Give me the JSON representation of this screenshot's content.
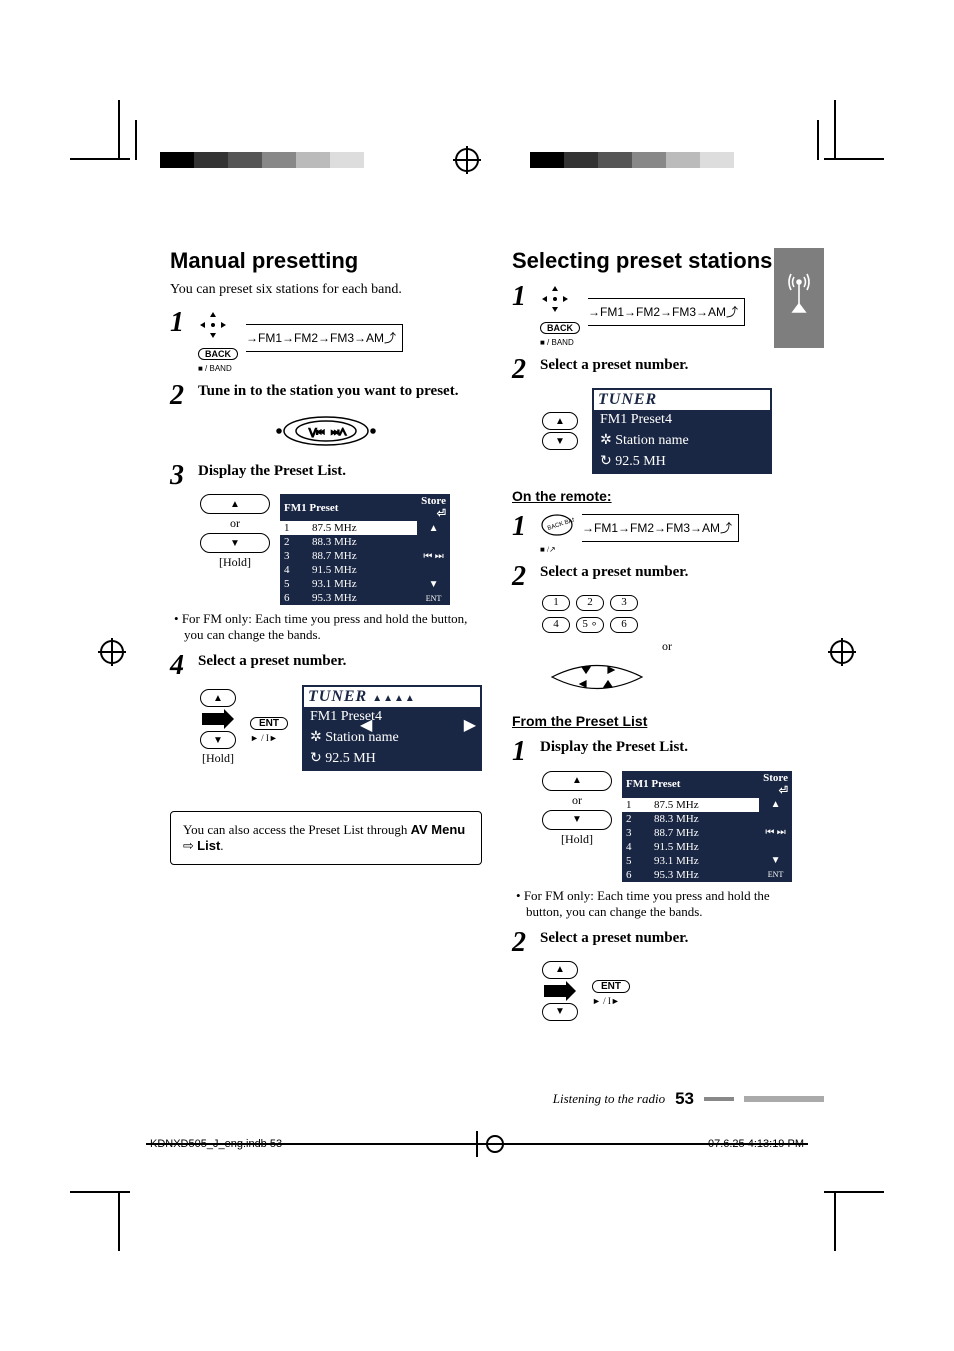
{
  "bands": [
    "FM1",
    "FM2",
    "FM3",
    "AM"
  ],
  "back_label": "BACK",
  "band_btn_label": "■ / BAND",
  "ent_label": "ENT",
  "play_label": "► / I►",
  "hold_label": "[Hold]",
  "or_label": "or",
  "store_label": "Store",
  "preset_list_title": "FM1 Preset",
  "presets": [
    {
      "n": "1",
      "f": "87.5 MHz"
    },
    {
      "n": "2",
      "f": "88.3 MHz"
    },
    {
      "n": "3",
      "f": "88.7 MHz"
    },
    {
      "n": "4",
      "f": "91.5 MHz"
    },
    {
      "n": "5",
      "f": "93.1 MHz"
    },
    {
      "n": "6",
      "f": "95.3 MHz"
    }
  ],
  "tuner_title": "TUNER",
  "tuner_line1": "FM1  Preset4",
  "tuner_line2": "Station name",
  "tuner_line3": "92.5    MH",
  "left": {
    "heading": "Manual presetting",
    "intro": "You can preset six stations for each band.",
    "step2": "Tune in to the station you want to preset.",
    "step3": "Display the Preset List.",
    "fm_note": "For FM only: Each time you press and hold the button, you can change the bands.",
    "step4": "Select a preset number.",
    "tip_prefix": "You can also access the Preset List through ",
    "tip_menu": "AV Menu",
    "tip_arrow": " ⇨ ",
    "tip_list": "List",
    "tip_suffix": "."
  },
  "right": {
    "heading": "Selecting preset stations",
    "step2": "Select a preset number.",
    "remote": "On the remote:",
    "remote_step2": "Select a preset number.",
    "from_list": "From the Preset List",
    "list_step1": "Display the Preset List.",
    "fm_note": "For FM only: Each time you press and hold the button, you can change the bands.",
    "list_step2": "Select a preset number."
  },
  "footer": {
    "section": "Listening to the radio",
    "page": "53"
  },
  "print": {
    "file": "KDNXD505_J_eng.indb   53",
    "date": "07.6.25   4:13:19 PM"
  }
}
